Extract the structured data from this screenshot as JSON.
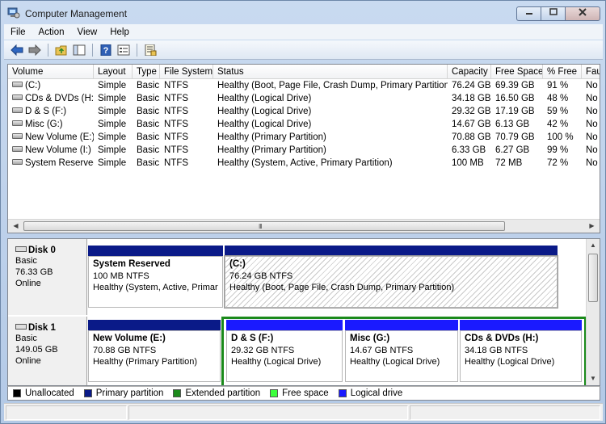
{
  "window": {
    "title": "Computer Management"
  },
  "caption_buttons": {
    "minimize": "▭",
    "maximize": "▢",
    "close": "✕"
  },
  "menu": [
    "File",
    "Action",
    "View",
    "Help"
  ],
  "toolbar": {
    "icons": [
      "back-arrow-icon",
      "forward-arrow-icon",
      "up-folder-icon",
      "show-hide-tree-icon",
      "help-icon",
      "properties-icon",
      "export-list-icon"
    ]
  },
  "volume_list": {
    "columns": [
      "Volume",
      "Layout",
      "Type",
      "File System",
      "Status",
      "Capacity",
      "Free Space",
      "% Free",
      "Fau"
    ],
    "rows": [
      {
        "volume": "(C:)",
        "layout": "Simple",
        "type": "Basic",
        "fs": "NTFS",
        "status": "Healthy (Boot, Page File, Crash Dump, Primary Partition)",
        "capacity": "76.24 GB",
        "free": "69.39 GB",
        "pct": "91 %",
        "fault": "No"
      },
      {
        "volume": "CDs & DVDs (H:)",
        "layout": "Simple",
        "type": "Basic",
        "fs": "NTFS",
        "status": "Healthy (Logical Drive)",
        "capacity": "34.18 GB",
        "free": "16.50 GB",
        "pct": "48 %",
        "fault": "No"
      },
      {
        "volume": "D & S (F:)",
        "layout": "Simple",
        "type": "Basic",
        "fs": "NTFS",
        "status": "Healthy (Logical Drive)",
        "capacity": "29.32 GB",
        "free": "17.19 GB",
        "pct": "59 %",
        "fault": "No"
      },
      {
        "volume": "Misc (G:)",
        "layout": "Simple",
        "type": "Basic",
        "fs": "NTFS",
        "status": "Healthy (Logical Drive)",
        "capacity": "14.67 GB",
        "free": "6.13 GB",
        "pct": "42 %",
        "fault": "No"
      },
      {
        "volume": "New Volume (E:)",
        "layout": "Simple",
        "type": "Basic",
        "fs": "NTFS",
        "status": "Healthy (Primary Partition)",
        "capacity": "70.88 GB",
        "free": "70.79 GB",
        "pct": "100 %",
        "fault": "No"
      },
      {
        "volume": "New Volume (I:)",
        "layout": "Simple",
        "type": "Basic",
        "fs": "NTFS",
        "status": "Healthy (Primary Partition)",
        "capacity": "6.33 GB",
        "free": "6.27 GB",
        "pct": "99 %",
        "fault": "No"
      },
      {
        "volume": "System Reserved",
        "layout": "Simple",
        "type": "Basic",
        "fs": "NTFS",
        "status": "Healthy (System, Active, Primary Partition)",
        "capacity": "100 MB",
        "free": "72 MB",
        "pct": "72 %",
        "fault": "No"
      }
    ],
    "scroll_grip": "III"
  },
  "disks": [
    {
      "name": "Disk 0",
      "type": "Basic",
      "size": "76.33 GB",
      "status": "Online",
      "partitions": [
        {
          "title": "System Reserved",
          "size": "100 MB NTFS",
          "status": "Healthy (System, Active, Primar"
        },
        {
          "title": "(C:)",
          "size": "76.24 GB NTFS",
          "status": "Healthy (Boot, Page File, Crash Dump, Primary Partition)"
        }
      ]
    },
    {
      "name": "Disk 1",
      "type": "Basic",
      "size": "149.05 GB",
      "status": "Online",
      "partitions": [
        {
          "title": "New Volume  (E:)",
          "size": "70.88 GB NTFS",
          "status": "Healthy (Primary Partition)"
        },
        {
          "title": "D & S  (F:)",
          "size": "29.32 GB NTFS",
          "status": "Healthy (Logical Drive)"
        },
        {
          "title": "Misc  (G:)",
          "size": "14.67 GB NTFS",
          "status": "Healthy (Logical Drive)"
        },
        {
          "title": "CDs & DVDs  (H:)",
          "size": "34.18 GB NTFS",
          "status": "Healthy (Logical Drive)"
        }
      ]
    }
  ],
  "legend": [
    {
      "label": "Unallocated",
      "color": "#000000"
    },
    {
      "label": "Primary partition",
      "color": "#0a1a88"
    },
    {
      "label": "Extended partition",
      "color": "#1b8a1b"
    },
    {
      "label": "Free space",
      "color": "#3cff3c"
    },
    {
      "label": "Logical drive",
      "color": "#1a1aff"
    }
  ],
  "colors": {
    "primary_bar": "#0a1a88",
    "logical_bar": "#1a1aff",
    "extended_border": "#1b8a1b"
  }
}
